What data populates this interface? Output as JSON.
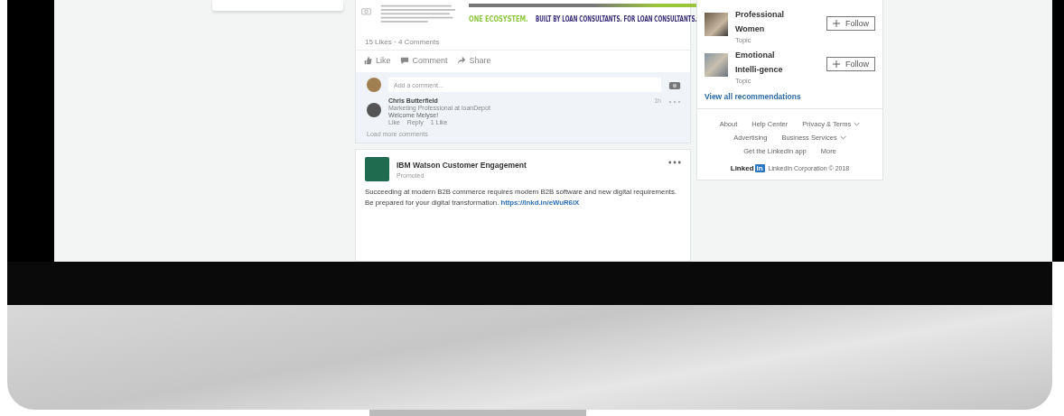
{
  "post": {
    "banner": {
      "lead": "ONE ECOSYSTEM.",
      "tagline": "BUILT BY LOAN CONSULTANTS. FOR LOAN CONSULTANTS."
    },
    "stats": "15 Likes · 4 Comments",
    "actions": [
      {
        "kind": "like",
        "label": "Like"
      },
      {
        "kind": "comment",
        "label": "Comment"
      },
      {
        "kind": "share",
        "label": "Share"
      }
    ],
    "comment_placeholder": "Add a comment...",
    "comment": {
      "author": "Chris Butterfield",
      "headline": "Marketing Professional at loanDepot",
      "time": "1h",
      "text": "Welcome Melyse!",
      "actions": [
        "Like",
        "Reply"
      ],
      "likes": "1 Like"
    },
    "load_more": "Load more comments"
  },
  "promoted_post": {
    "author": "IBM Watson Customer Engagement",
    "label": "Promoted",
    "text": "Succeeding at modern B2B commerce requires modern B2B software and new digital requirements. Be prepared for your digital transformation.",
    "link": "https://lnkd.in/eWuR6iX"
  },
  "recommendations": {
    "items": [
      {
        "name": "Professional Women",
        "type": "Topic",
        "button": "Follow"
      },
      {
        "name": "Emotional Intelli-gence",
        "type": "Topic",
        "button": "Follow"
      }
    ],
    "view_all": "View all recommendations"
  },
  "footer": {
    "links": [
      {
        "label": "About",
        "dropdown": false
      },
      {
        "label": "Help Center",
        "dropdown": false
      },
      {
        "label": "Privacy & Terms",
        "dropdown": true
      },
      {
        "label": "Advertising",
        "dropdown": false
      },
      {
        "label": "Business Services",
        "dropdown": true
      },
      {
        "label": "Get the LinkedIn app",
        "dropdown": false
      },
      {
        "label": "More",
        "dropdown": false
      }
    ],
    "logo_word": "Linked",
    "logo_mark": "in",
    "copyright": "LinkedIn Corporation © 2018"
  }
}
